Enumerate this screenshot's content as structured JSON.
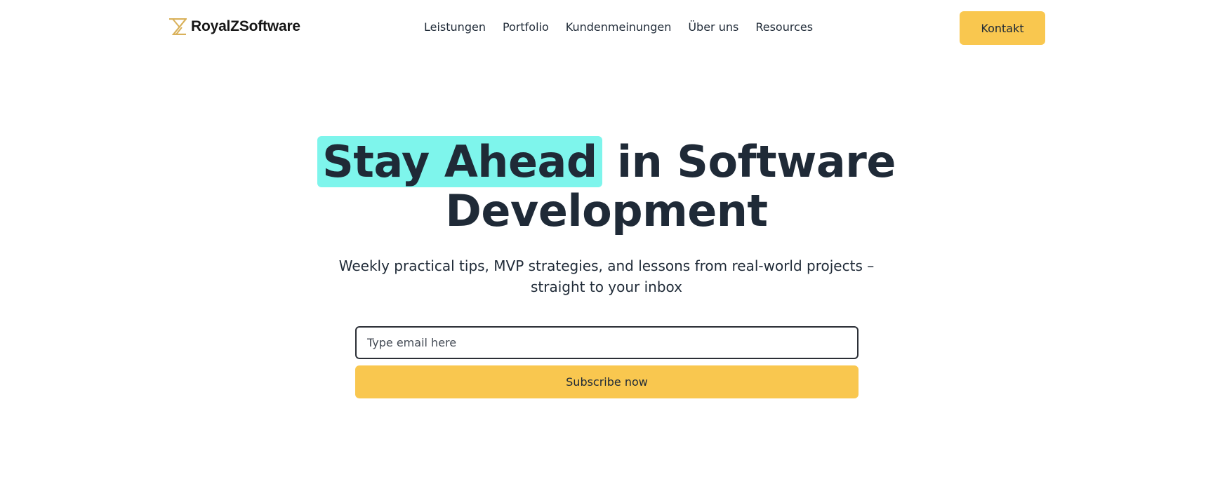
{
  "header": {
    "logo_icon": "royalz-logo-icon",
    "brand_name": "RoyalZSoftware",
    "nav": [
      {
        "label": "Leistungen"
      },
      {
        "label": "Portfolio"
      },
      {
        "label": "Kundenmeinungen"
      },
      {
        "label": "Über uns"
      },
      {
        "label": "Resources"
      }
    ],
    "cta_label": "Kontakt"
  },
  "hero": {
    "title_highlight": "Stay Ahead",
    "title_rest_line1": "in Software",
    "title_line2": "Development",
    "subtitle_line1": "Weekly practical tips, MVP strategies, and lessons from real-world projects –",
    "subtitle_line2": "straight to your inbox",
    "email_placeholder": "Type email here",
    "email_value": "",
    "subscribe_label": "Subscribe now"
  },
  "colors": {
    "accent_yellow": "#f9c74f",
    "highlight_cyan": "#7ef5ec",
    "text_dark": "#1f2a37",
    "logo_gold": "#d9b15a"
  }
}
